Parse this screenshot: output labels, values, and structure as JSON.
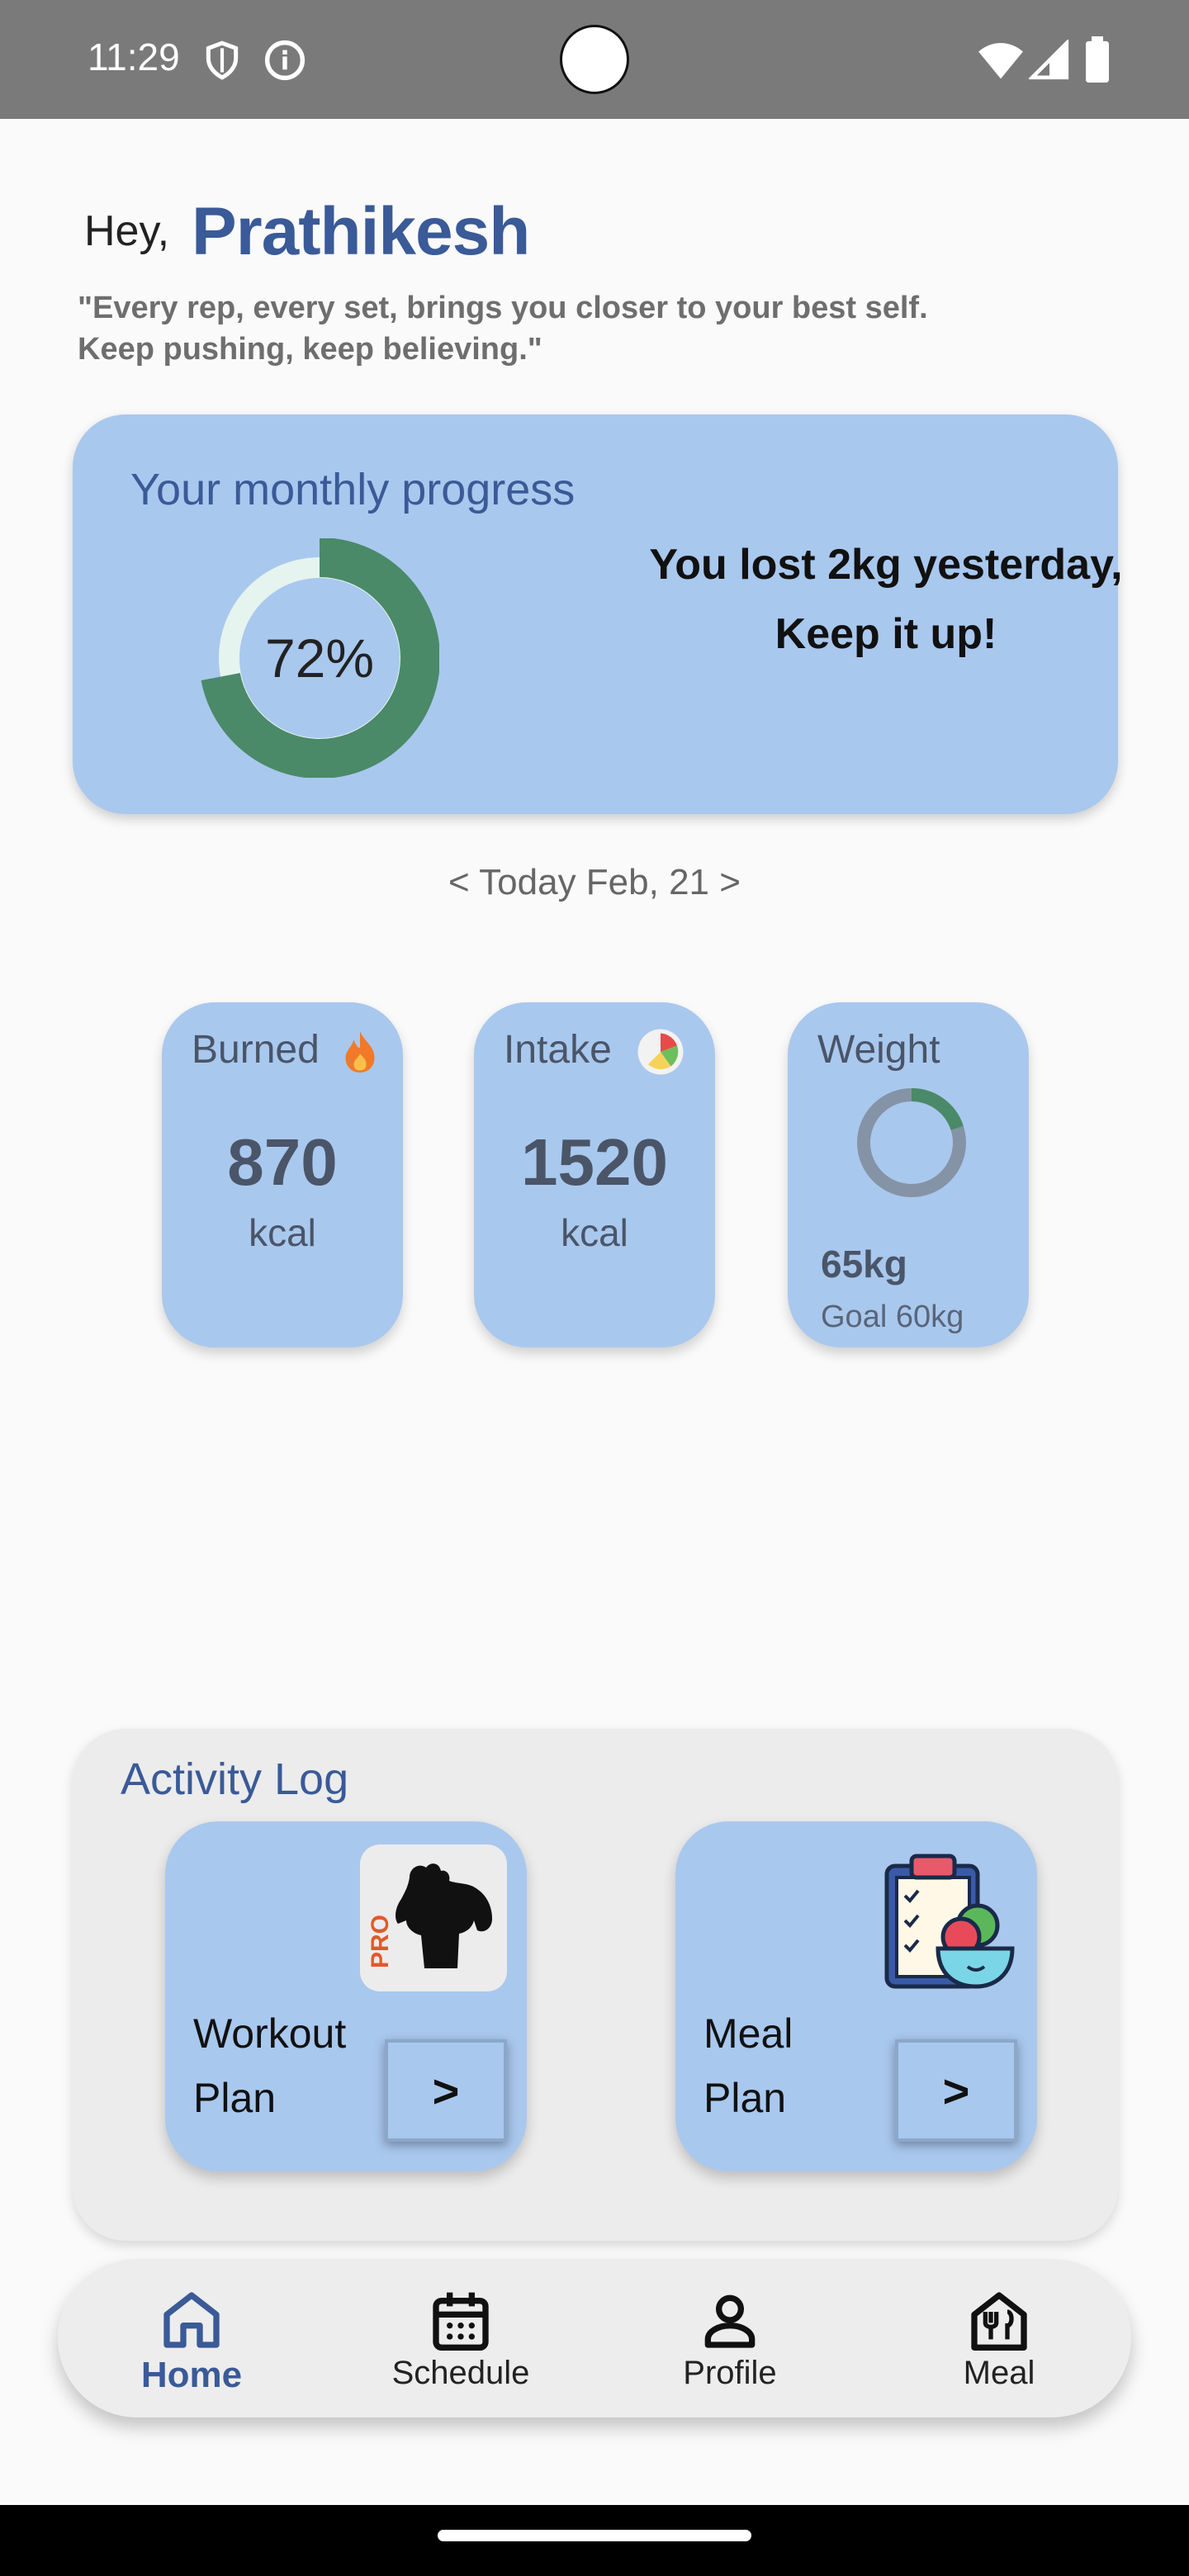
{
  "status_bar": {
    "time": "11:29",
    "icons": [
      "shield-icon",
      "info-icon",
      "wifi-icon",
      "signal-icon",
      "battery-icon"
    ]
  },
  "greeting": {
    "hey": "Hey,",
    "name": "Prathikesh",
    "quote": "\"Every rep, every set, brings you closer to your best self.\n Keep pushing, keep believing.\""
  },
  "progress": {
    "title": "Your monthly progress",
    "percent_label": "72%",
    "percent": 72,
    "message": "You lost 2kg yesterday, Keep it up!"
  },
  "date_nav": "< Today Feb, 21 >",
  "stats": {
    "burned": {
      "label": "Burned",
      "value": "870",
      "unit": "kcal",
      "icon": "fire-icon"
    },
    "intake": {
      "label": "Intake",
      "value": "1520",
      "unit": "kcal",
      "icon": "salad-icon"
    },
    "weight": {
      "label": "Weight",
      "current": "65kg",
      "goal": "Goal 60kg",
      "progress_fraction": 0.2
    }
  },
  "activity": {
    "title": "Activity Log",
    "workout": {
      "label": "Workout\nPlan",
      "go": ">",
      "image_text": "PRO"
    },
    "meal": {
      "label": "Meal\nPlan",
      "go": ">"
    }
  },
  "nav": {
    "items": [
      {
        "label": "Home",
        "icon": "home-icon",
        "active": true
      },
      {
        "label": "Schedule",
        "icon": "calendar-icon",
        "active": false
      },
      {
        "label": "Profile",
        "icon": "profile-icon",
        "active": false
      },
      {
        "label": "Meal",
        "icon": "meal-icon",
        "active": false
      }
    ]
  },
  "colors": {
    "card": "#a9c8ee",
    "accent": "#3a5a98",
    "ring": "#4a8a68",
    "ring_track": "#e6f4ef"
  }
}
